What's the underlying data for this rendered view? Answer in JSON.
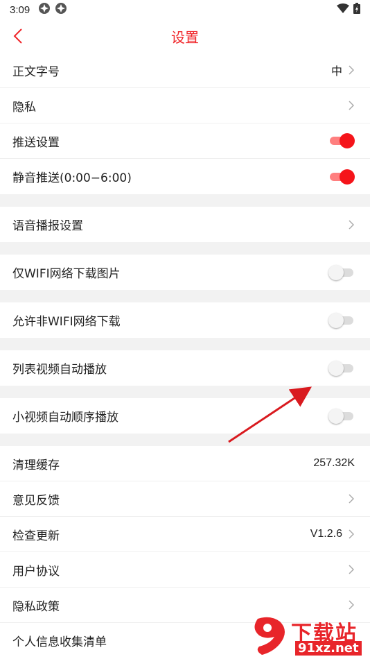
{
  "status_bar": {
    "time": "3:09"
  },
  "header": {
    "title": "设置"
  },
  "groups": {
    "g1": {
      "font_size": {
        "label": "正文字号",
        "value": "中"
      },
      "privacy": {
        "label": "隐私"
      },
      "push": {
        "label": "推送设置",
        "on": true
      },
      "silent_push": {
        "label": "静音推送(0:00−6:00)",
        "on": true
      }
    },
    "g2": {
      "voice": {
        "label": "语音播报设置"
      }
    },
    "g3": {
      "wifi_images": {
        "label": "仅WIFI网络下载图片",
        "on": false
      }
    },
    "g4": {
      "non_wifi": {
        "label": "允许非WIFI网络下载",
        "on": false
      }
    },
    "g5": {
      "autoplay": {
        "label": "列表视频自动播放",
        "on": false
      }
    },
    "g6": {
      "short_video": {
        "label": "小视频自动顺序播放",
        "on": false
      }
    },
    "g7": {
      "cache": {
        "label": "清理缓存",
        "value": "257.32K"
      },
      "feedback": {
        "label": "意见反馈"
      },
      "update": {
        "label": "检查更新",
        "value": "V1.2.6"
      },
      "agreement": {
        "label": "用户协议"
      },
      "policy": {
        "label": "隐私政策"
      },
      "personal_info": {
        "label": "个人信息收集清单"
      }
    }
  },
  "watermark": {
    "brand": "下载站",
    "url": "91xz.net"
  },
  "colors": {
    "accent": "#f0262a",
    "toggle_on": "#f5141a",
    "toggle_off": "#dcdcdc",
    "separator": "#f2f2f2"
  }
}
